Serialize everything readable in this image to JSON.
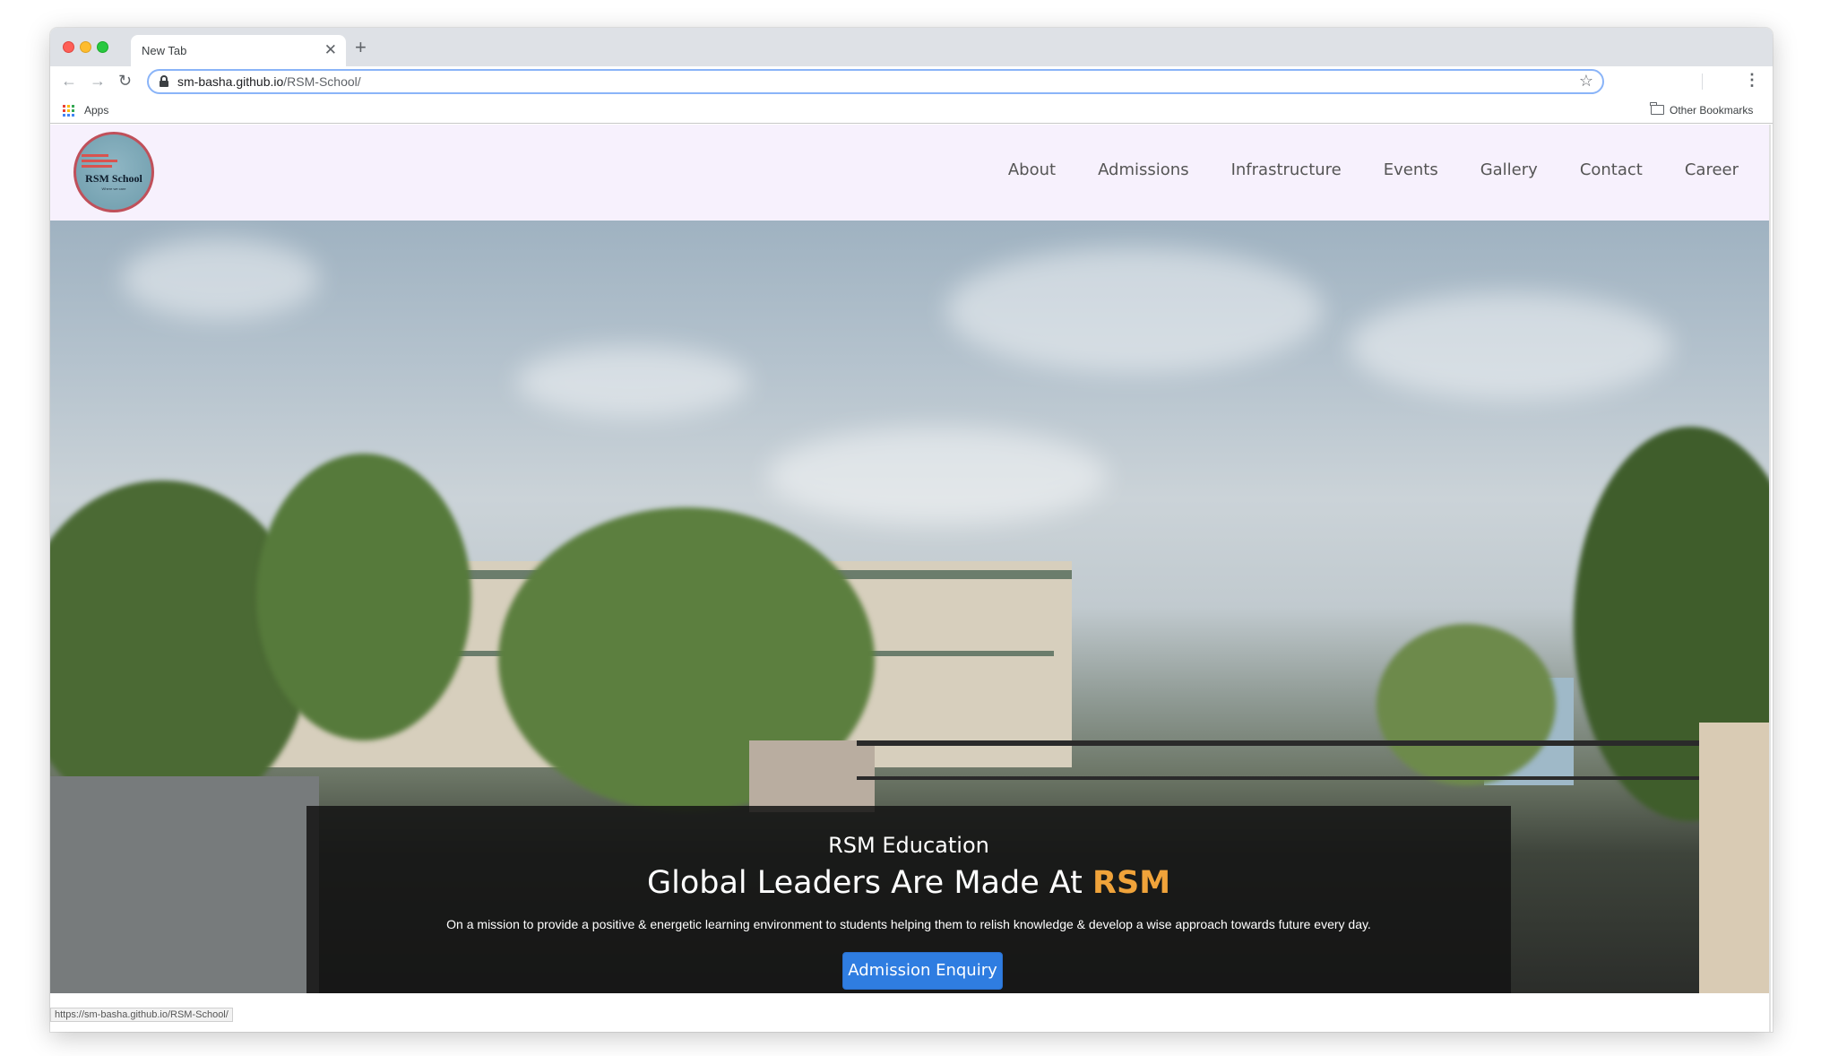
{
  "browser": {
    "tab_title": "New Tab",
    "tab_close": "✕",
    "new_tab": "+",
    "url_host": "sm-basha.github.io",
    "url_path": "/RSM-School/",
    "bookmarks": {
      "apps_label": "Apps",
      "other_label": "Other Bookmarks"
    },
    "status_url": "https://sm-basha.github.io/RSM-School/"
  },
  "site": {
    "logo_text": "RSM School",
    "logo_tagline": "Where we care",
    "nav": [
      {
        "label": "About"
      },
      {
        "label": "Admissions"
      },
      {
        "label": "Infrastructure"
      },
      {
        "label": "Events"
      },
      {
        "label": "Gallery"
      },
      {
        "label": "Contact"
      },
      {
        "label": "Career"
      }
    ],
    "hero": {
      "subtitle": "RSM Education",
      "title_main": "Global Leaders Are Made At ",
      "title_accent": "RSM",
      "description": "On a mission to provide a positive & energetic learning environment to students helping them to relish knowledge & develop a wise approach towards future every day.",
      "cta_label": "Admission Enquiry"
    }
  },
  "colors": {
    "nav_background": "#f7f1fd",
    "accent_orange": "#f0a33a",
    "cta_blue": "#2f7de1"
  }
}
